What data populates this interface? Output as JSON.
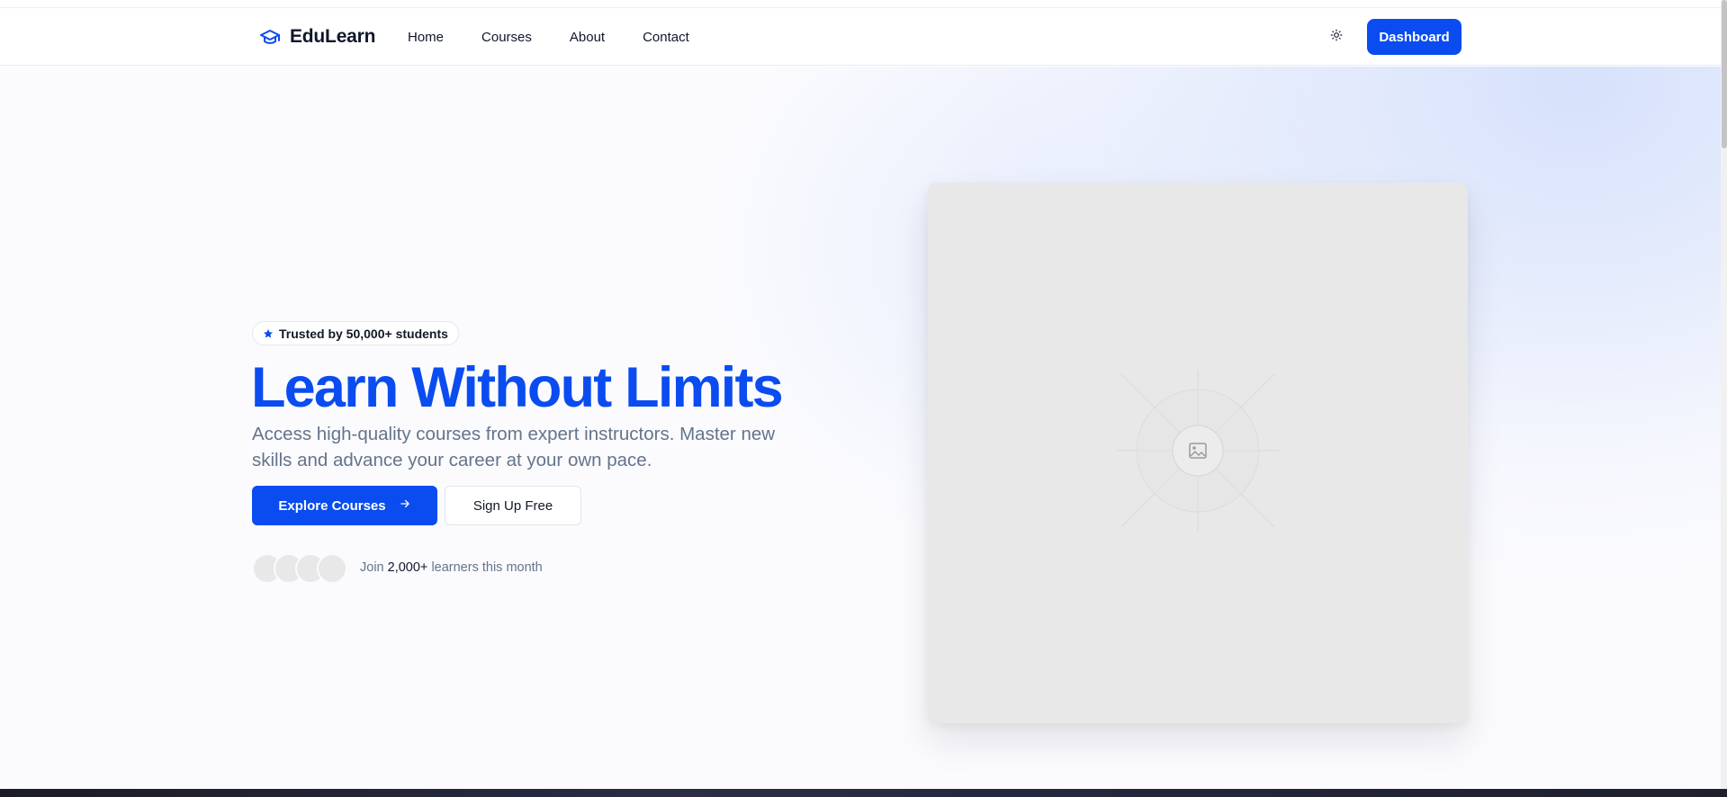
{
  "nav": {
    "brand": "EduLearn",
    "brand_icon": "graduation-cap-icon",
    "links": [
      "Home",
      "Courses",
      "About",
      "Contact"
    ],
    "theme_icon": "sun-icon",
    "dashboard_label": "Dashboard"
  },
  "hero": {
    "badge_icon": "star-icon",
    "badge_text": "Trusted by 50,000+ students",
    "headline": "Learn Without Limits",
    "subtext": "Access high-quality courses from expert instructors. Master new skills and advance your career at your own pace.",
    "primary_cta": "Explore Courses",
    "primary_cta_icon": "arrow-right-icon",
    "secondary_cta": "Sign Up Free",
    "social_prefix": "Join",
    "social_count": "2,000+",
    "social_suffix": "learners this month",
    "avatar_count": 4,
    "image_icon": "image-placeholder-icon"
  },
  "colors": {
    "accent": "#0a4cf0",
    "text_muted": "#64748b",
    "placeholder_bg": "#e8e8e8"
  }
}
